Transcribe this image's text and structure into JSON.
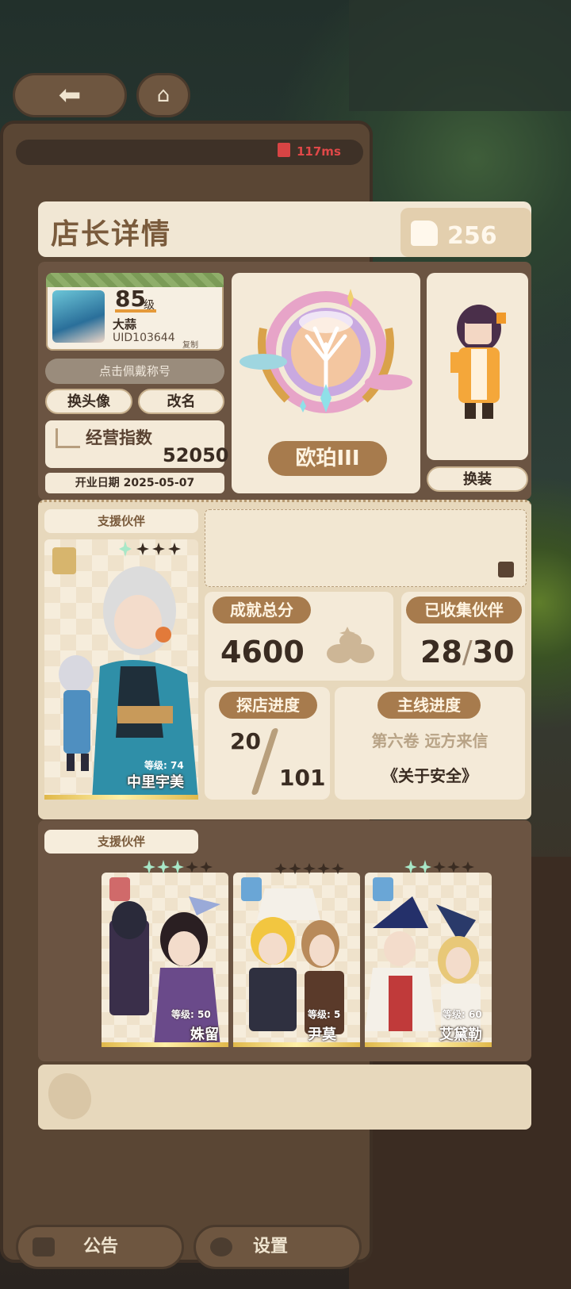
{
  "top": {
    "ping": "117ms"
  },
  "header": {
    "title": "店长详情",
    "likes": "256"
  },
  "profile": {
    "level": "85",
    "level_unit": "级",
    "name": "大蒜",
    "uid": "UID103644",
    "copy_label": "复制",
    "title_button": "点击佩戴称号",
    "change_avatar": "换头像",
    "rename": "改名",
    "business_index_label": "经营指数",
    "business_index_value": "52050",
    "open_date": "开业日期 2025-05-07"
  },
  "rank": {
    "name": "欧珀III"
  },
  "character": {
    "outfit_button": "换装"
  },
  "support_partner": {
    "label": "支援伙伴",
    "level": "等级: 74",
    "name": "中里宇美",
    "stars": 4
  },
  "stats": {
    "achievement_label": "成就总分",
    "achievement_value": "4600",
    "collected_label": "已收集伙伴",
    "collected_current": "28",
    "collected_total": "30",
    "exploration_label": "探店进度",
    "exploration_current": "20",
    "exploration_total": "101",
    "main_story_label": "主线进度",
    "main_story_volume": "第六卷 远方来信",
    "main_story_chapter": "《关于安全》"
  },
  "team": {
    "label": "支援伙伴",
    "members": [
      {
        "level": "等级: 50",
        "name": "姝留",
        "badge_color": "#d06a6a"
      },
      {
        "level": "等级: 5",
        "name": "尹莫",
        "badge_color": "#6aa6d6"
      },
      {
        "level": "等级: 60",
        "name": "艾黛勒",
        "badge_color": "#6aa6d6"
      }
    ]
  },
  "bottom": {
    "notice": "公告",
    "settings": "设置"
  },
  "colors": {
    "accent_brown": "#a77b4d",
    "panel_cream": "#f4ead8",
    "ping_red": "#e04848"
  }
}
